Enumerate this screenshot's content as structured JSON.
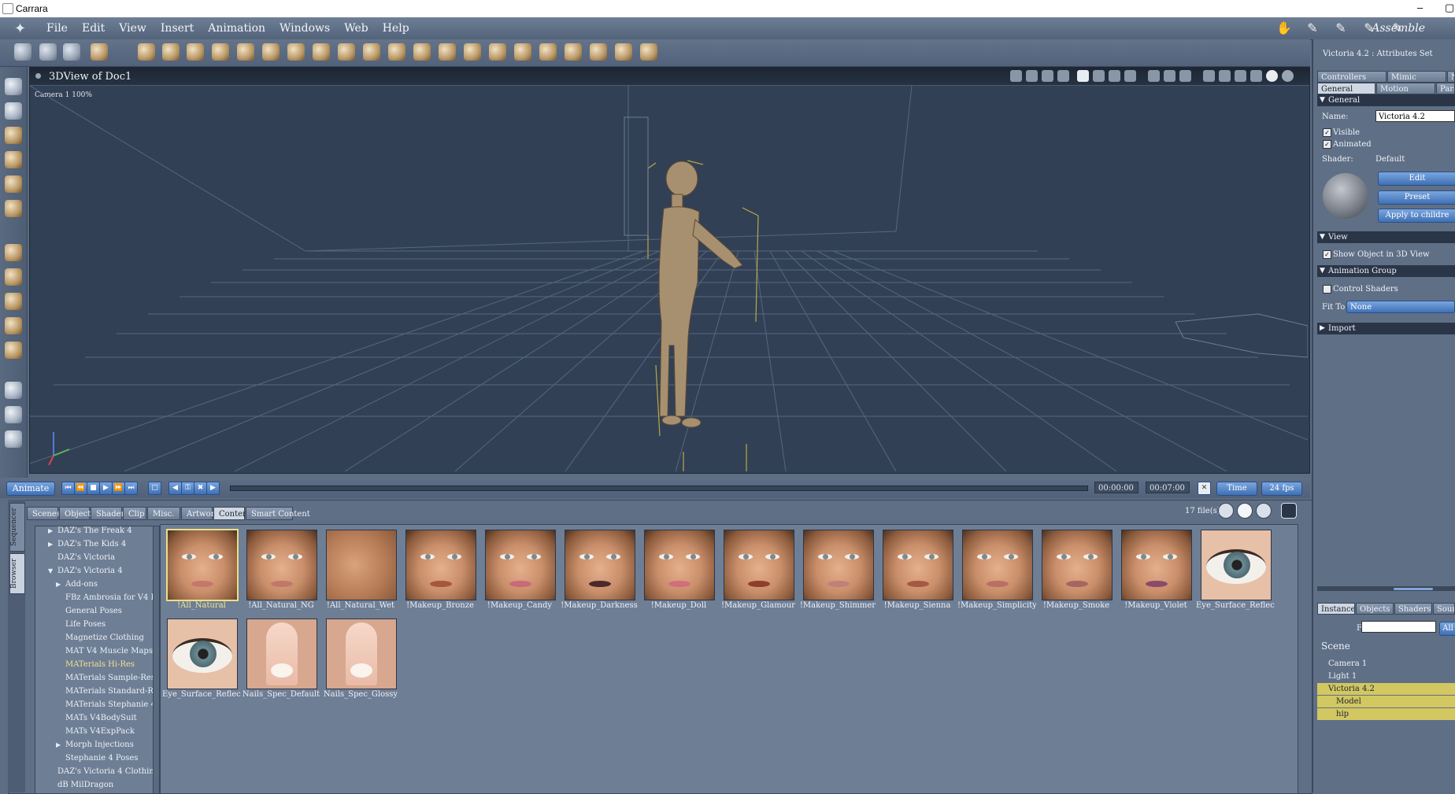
{
  "window": {
    "title": "Carrara"
  },
  "menu": {
    "items": [
      "File",
      "Edit",
      "View",
      "Insert",
      "Animation",
      "Windows",
      "Web",
      "Help"
    ]
  },
  "rooms": {
    "current": "Assemble"
  },
  "view3d": {
    "title": "3DView of Doc1",
    "camera_label": "Camera 1 100%"
  },
  "timeline": {
    "animate_label": "Animate",
    "start_time": "00:00:00",
    "end_time": "00:07:00",
    "mode": "Time",
    "fps": "24 fps"
  },
  "browser": {
    "side_tabs": [
      "Sequencer",
      "Browser"
    ],
    "tabs": [
      "Scenes",
      "Objects",
      "Shaders",
      "Clip",
      "Misc.",
      "Artwork",
      "Content",
      "Smart Content"
    ],
    "active_tab": "Content",
    "file_count": "17 file(s).",
    "tree": [
      {
        "label": "DAZ's The Freak 4",
        "indent": 1,
        "expander": "right"
      },
      {
        "label": "DAZ's The Kids 4",
        "indent": 1,
        "expander": "right"
      },
      {
        "label": "DAZ's Victoria",
        "indent": 1,
        "expander": ""
      },
      {
        "label": "DAZ's Victoria 4",
        "indent": 1,
        "expander": "down"
      },
      {
        "label": "Add-ons",
        "indent": 2,
        "expander": "right"
      },
      {
        "label": "FBz Ambrosia for V4 Pu",
        "indent": 2,
        "expander": ""
      },
      {
        "label": "General Poses",
        "indent": 2,
        "expander": ""
      },
      {
        "label": "Life Poses",
        "indent": 2,
        "expander": ""
      },
      {
        "label": "Magnetize Clothing",
        "indent": 2,
        "expander": ""
      },
      {
        "label": "MAT V4 Muscle Maps",
        "indent": 2,
        "expander": ""
      },
      {
        "label": "MATerials Hi-Res",
        "indent": 2,
        "expander": "",
        "selected": true
      },
      {
        "label": "MATerials Sample-Res",
        "indent": 2,
        "expander": ""
      },
      {
        "label": "MATerials Standard-Res",
        "indent": 2,
        "expander": ""
      },
      {
        "label": "MATerials Stephanie 4",
        "indent": 2,
        "expander": ""
      },
      {
        "label": "MATs V4BodySuit",
        "indent": 2,
        "expander": ""
      },
      {
        "label": "MATs V4ExpPack",
        "indent": 2,
        "expander": ""
      },
      {
        "label": "Morph Injections",
        "indent": 2,
        "expander": "right"
      },
      {
        "label": "Stephanie 4 Poses",
        "indent": 2,
        "expander": ""
      },
      {
        "label": "DAZ's Victoria 4 Clothing",
        "indent": 1,
        "expander": ""
      },
      {
        "label": "dB MilDragon",
        "indent": 1,
        "expander": ""
      }
    ],
    "thumbs": [
      {
        "label": "!All_Natural",
        "kind": "face",
        "lip": "#c2786a",
        "selected": true
      },
      {
        "label": "!All_Natural_NG",
        "kind": "face",
        "lip": "#c0786a"
      },
      {
        "label": "!All_Natural_Wet",
        "kind": "skin",
        "lip": ""
      },
      {
        "label": "!Makeup_Bronze",
        "kind": "face",
        "lip": "#a5573e"
      },
      {
        "label": "!Makeup_Candy",
        "kind": "face",
        "lip": "#c86a7a"
      },
      {
        "label": "!Makeup_Darkness",
        "kind": "face",
        "lip": "#4a2a2a"
      },
      {
        "label": "!Makeup_Doll",
        "kind": "face",
        "lip": "#d26d7e"
      },
      {
        "label": "!Makeup_Glamour",
        "kind": "face",
        "lip": "#8e3e2a"
      },
      {
        "label": "!Makeup_Shimmer",
        "kind": "face",
        "lip": "#c0807a"
      },
      {
        "label": "!Makeup_Sienna",
        "kind": "face",
        "lip": "#a35a45"
      },
      {
        "label": "!Makeup_Simplicity",
        "kind": "face",
        "lip": "#b87065"
      },
      {
        "label": "!Makeup_Smoke",
        "kind": "face",
        "lip": "#a56560"
      },
      {
        "label": "!Makeup_Violet",
        "kind": "face",
        "lip": "#8a4a6a"
      },
      {
        "label": "Eye_Surface_Reflect_",
        "kind": "eye",
        "lip": ""
      },
      {
        "label": "Eye_Surface_Reflect_",
        "kind": "eye",
        "lip": ""
      },
      {
        "label": "Nails_Spec_Default",
        "kind": "nail",
        "lip": ""
      },
      {
        "label": "Nails_Spec_Glossy",
        "kind": "nail",
        "lip": ""
      }
    ]
  },
  "attributes": {
    "title": "Victoria 4.2 : Attributes Set",
    "tabs_row1": [
      "Controllers",
      "Mimic",
      "N"
    ],
    "tabs_row2": [
      "General",
      "Motion",
      "Para"
    ],
    "general_header": "General",
    "name_label": "Name:",
    "name_value": "Victoria 4.2",
    "visible_label": "Visible",
    "animated_label": "Animated",
    "shader_label": "Shader:",
    "shader_value": "Default",
    "edit_button": "Edit",
    "preset_button": "Preset",
    "apply_button": "Apply to childre",
    "view_header": "View",
    "show_in_3d_label": "Show Object in 3D View",
    "animation_group_header": "Animation Group",
    "control_shaders_label": "Control Shaders",
    "fit_to_label": "Fit To",
    "fit_to_value": "None",
    "import_header": "Import"
  },
  "instances": {
    "tabs": [
      "Instances",
      "Objects",
      "Shaders",
      "Sounds"
    ],
    "find_label": "Find:",
    "find_value": "",
    "all_button": "All",
    "scene_label": "Scene",
    "items": [
      {
        "label": "Camera 1",
        "indent": 1,
        "highlight": false
      },
      {
        "label": "Light 1",
        "indent": 1,
        "highlight": false
      },
      {
        "label": "Victoria 4.2",
        "indent": 1,
        "highlight": true
      },
      {
        "label": "Model",
        "indent": 2,
        "highlight": true
      },
      {
        "label": "hip",
        "indent": 2,
        "highlight": true
      }
    ]
  },
  "colors": {
    "accent_yellow": "#d2c761",
    "panel": "#5f6f86",
    "viewport": "#324055",
    "button_blue": "#3f70b5"
  }
}
